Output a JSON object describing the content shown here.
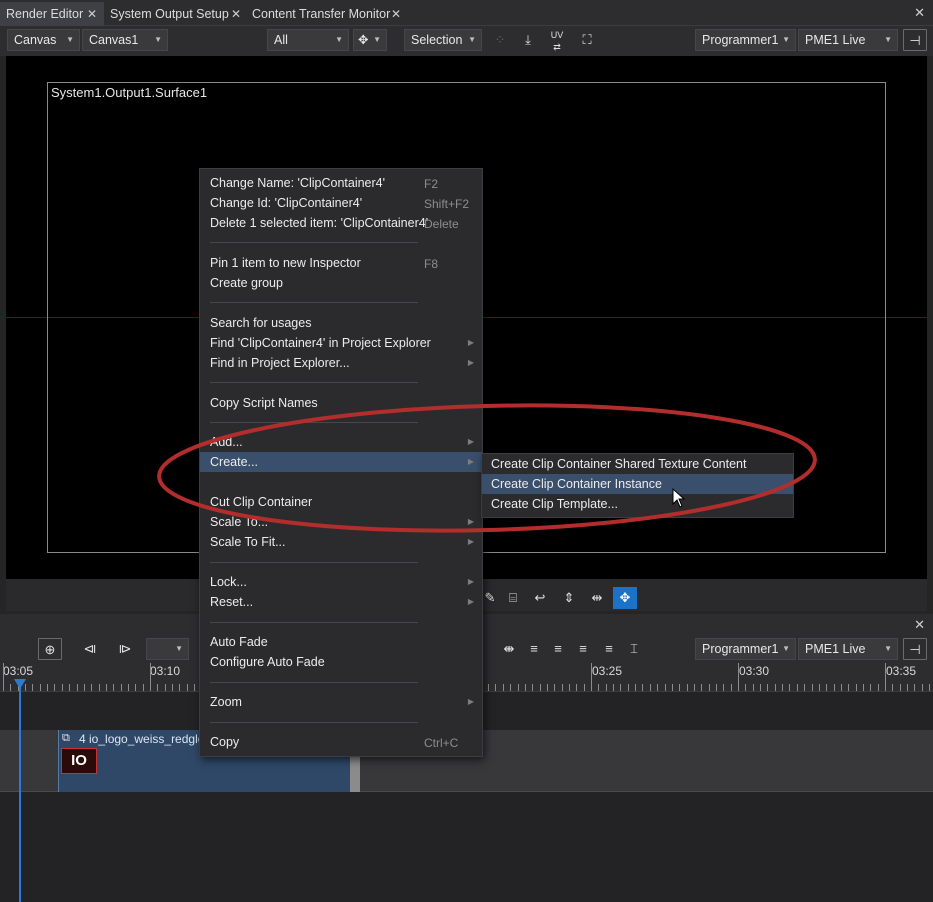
{
  "tabs": [
    {
      "label": "Render Editor",
      "active": true
    },
    {
      "label": "System Output Setup",
      "active": false
    },
    {
      "label": "Content Transfer Monitor",
      "active": false
    }
  ],
  "toolbar": {
    "canvas_type": "Canvas",
    "canvas_name": "Canvas1",
    "filter": "All",
    "mode": "Selection",
    "uv_label": "UV",
    "programmer": "Programmer1",
    "output": "PME1 Live"
  },
  "viewport": {
    "surface_label": "System1.Output1.Surface1"
  },
  "context_menu": {
    "items": [
      {
        "label": "Change Name: 'ClipContainer4'",
        "shortcut": "F2"
      },
      {
        "label": "Change Id: 'ClipContainer4'",
        "shortcut": "Shift+F2"
      },
      {
        "label": "Delete 1 selected item: 'ClipContainer4'",
        "shortcut": "Delete"
      },
      {
        "label": "Pin 1 item to new Inspector",
        "shortcut": "F8"
      },
      {
        "label": "Create group",
        "shortcut": ""
      },
      {
        "label": "Search for usages",
        "shortcut": ""
      },
      {
        "label": "Find 'ClipContainer4' in Project Explorer",
        "shortcut": ""
      },
      {
        "label": "Find in Project Explorer...",
        "shortcut": ""
      },
      {
        "label": "Copy Script Names",
        "shortcut": ""
      },
      {
        "label": "Add...",
        "shortcut": ""
      },
      {
        "label": "Create...",
        "shortcut": ""
      },
      {
        "label": "Cut Clip Container",
        "shortcut": ""
      },
      {
        "label": "Scale To...",
        "shortcut": ""
      },
      {
        "label": "Scale To Fit...",
        "shortcut": ""
      },
      {
        "label": "Lock...",
        "shortcut": ""
      },
      {
        "label": "Reset...",
        "shortcut": ""
      },
      {
        "label": "Auto Fade",
        "shortcut": ""
      },
      {
        "label": "Configure Auto Fade",
        "shortcut": ""
      },
      {
        "label": "Zoom",
        "shortcut": ""
      },
      {
        "label": "Copy",
        "shortcut": "Ctrl+C"
      }
    ]
  },
  "submenu": {
    "items": [
      {
        "label": "Create Clip Container Shared Texture Content"
      },
      {
        "label": "Create Clip Container Instance"
      },
      {
        "label": "Create Clip Template..."
      }
    ]
  },
  "timeline": {
    "programmer": "Programmer1",
    "output": "PME1 Live",
    "ticks": [
      "03:05",
      "03:10",
      "03:25",
      "03:30",
      "03:35"
    ],
    "clip_title": "4 io_logo_weiss_redglo",
    "clip_logo": "IO"
  },
  "colors": {
    "accent": "#1a73c7",
    "highlight": "#3a4f6c",
    "annotation": "#b32d2d",
    "clip": "#2f4868"
  },
  "icons": [
    "close-icon",
    "move-icon",
    "snap-icon",
    "uv-icon",
    "frame-icon",
    "pin-icon",
    "camera-icon",
    "undo-icon",
    "align-icon",
    "stretch-icon",
    "navigate-icon",
    "marker-icon",
    "expand-icon",
    "collapse-icon"
  ]
}
